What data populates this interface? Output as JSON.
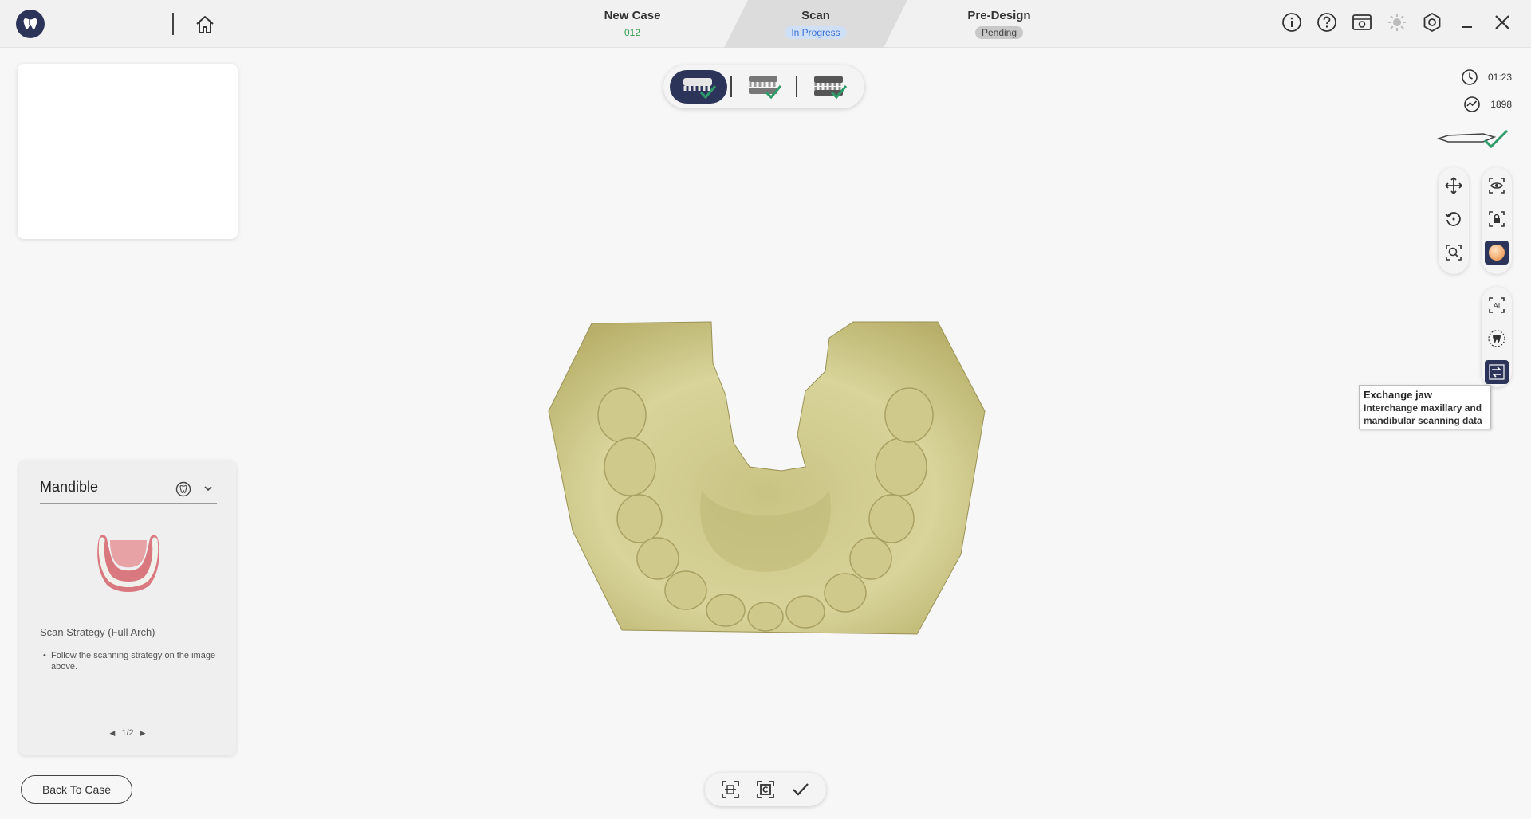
{
  "header": {
    "steps": [
      {
        "title": "New Case",
        "badge": "012"
      },
      {
        "title": "Scan",
        "badge": "In Progress"
      },
      {
        "title": "Pre-Design",
        "badge": "Pending"
      }
    ],
    "icons": [
      "info-icon",
      "help-icon",
      "screen-record-icon",
      "brightness-icon",
      "settings-icon",
      "minimize-icon",
      "close-icon"
    ]
  },
  "stats": {
    "time": "01:23",
    "frames": "1898"
  },
  "guide": {
    "title": "Mandible",
    "strategy_title": "Scan Strategy (Full Arch)",
    "strategy_text": "Follow the scanning strategy on the image above.",
    "page": "1/2"
  },
  "back_button": "Back To Case",
  "tooltip": {
    "title": "Exchange jaw",
    "description": "Interchange maxillary and mandibular scanning data"
  },
  "colors": {
    "accent": "#2c3559",
    "model": "#d8d49a",
    "badge_blue": "#cfe0f6"
  }
}
